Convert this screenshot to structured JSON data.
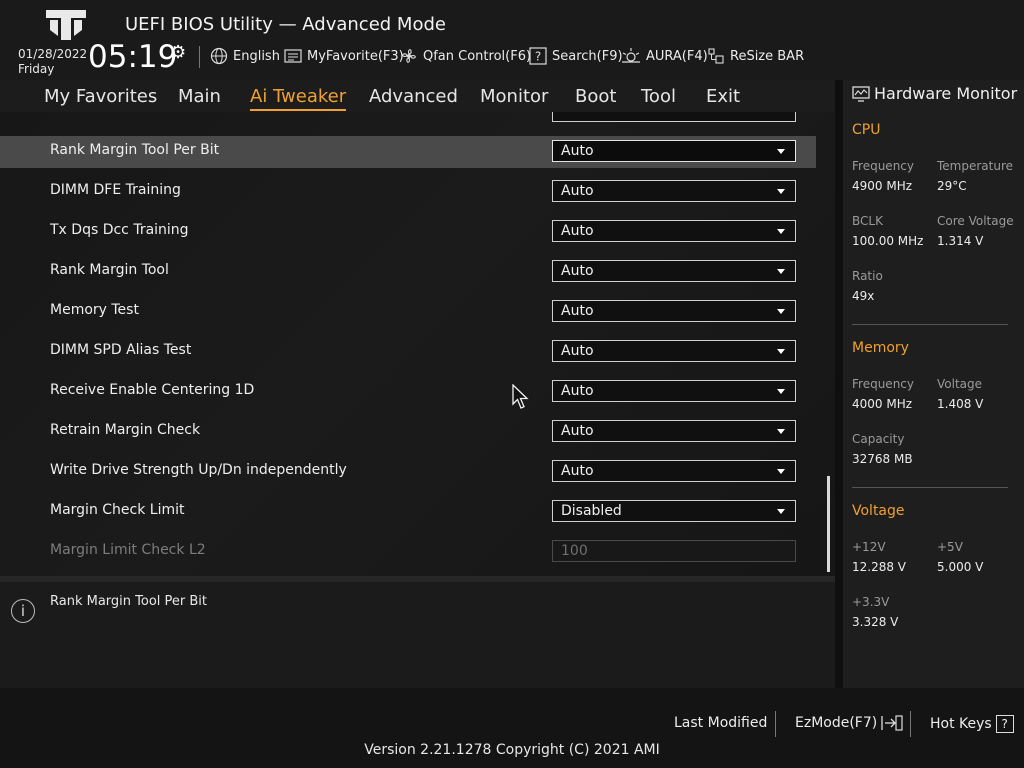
{
  "header": {
    "title": "UEFI BIOS Utility — Advanced Mode",
    "date": "01/28/2022",
    "day": "Friday",
    "time": "05:19",
    "toolbar": [
      {
        "label": "English",
        "icon": "globe-icon"
      },
      {
        "label": "MyFavorite(F3)",
        "icon": "favorite-icon"
      },
      {
        "label": "Qfan Control(F6)",
        "icon": "fan-icon"
      },
      {
        "label": "Search(F9)",
        "icon": "search-icon"
      },
      {
        "label": "AURA(F4)",
        "icon": "aura-icon"
      },
      {
        "label": "ReSize BAR",
        "icon": "resize-bar-icon"
      }
    ]
  },
  "menu": {
    "tabs": [
      "My Favorites",
      "Main",
      "Ai Tweaker",
      "Advanced",
      "Monitor",
      "Boot",
      "Tool",
      "Exit"
    ],
    "active": "Ai Tweaker"
  },
  "settings": [
    {
      "label": "Rank Margin Tool Per Bit",
      "value": "Auto"
    },
    {
      "label": "DIMM DFE Training",
      "value": "Auto"
    },
    {
      "label": "Tx Dqs Dcc Training",
      "value": "Auto"
    },
    {
      "label": "Rank Margin Tool",
      "value": "Auto"
    },
    {
      "label": "Memory Test",
      "value": "Auto"
    },
    {
      "label": "DIMM SPD Alias Test",
      "value": "Auto"
    },
    {
      "label": "Receive Enable Centering 1D",
      "value": "Auto"
    },
    {
      "label": "Retrain Margin Check",
      "value": "Auto"
    },
    {
      "label": "Write Drive Strength Up/Dn independently",
      "value": "Auto"
    },
    {
      "label": "Margin Check Limit",
      "value": "Disabled"
    },
    {
      "label": "Margin Limit Check L2",
      "value": "100"
    }
  ],
  "help": {
    "text": "Rank Margin Tool Per Bit"
  },
  "hardware_monitor": {
    "title": "Hardware Monitor",
    "cpu": {
      "heading": "CPU",
      "frequency_label": "Frequency",
      "frequency": "4900 MHz",
      "temperature_label": "Temperature",
      "temperature": "29°C",
      "bclk_label": "BCLK",
      "bclk": "100.00 MHz",
      "core_voltage_label": "Core Voltage",
      "core_voltage": "1.314 V",
      "ratio_label": "Ratio",
      "ratio": "49x"
    },
    "memory": {
      "heading": "Memory",
      "frequency_label": "Frequency",
      "frequency": "4000 MHz",
      "voltage_label": "Voltage",
      "voltage": "1.408 V",
      "capacity_label": "Capacity",
      "capacity": "32768 MB"
    },
    "voltage": {
      "heading": "Voltage",
      "v12_label": "+12V",
      "v12": "12.288 V",
      "v5_label": "+5V",
      "v5": "5.000 V",
      "v33_label": "+3.3V",
      "v33": "3.328 V"
    }
  },
  "footer": {
    "last_modified": "Last Modified",
    "ezmode": "EzMode(F7)",
    "hotkeys": "Hot Keys",
    "hotkeys_key": "?",
    "version": "Version 2.21.1278 Copyright (C) 2021 AMI"
  },
  "colors": {
    "accent": "#f0a030",
    "highlight_row": "#4a4a4a"
  }
}
